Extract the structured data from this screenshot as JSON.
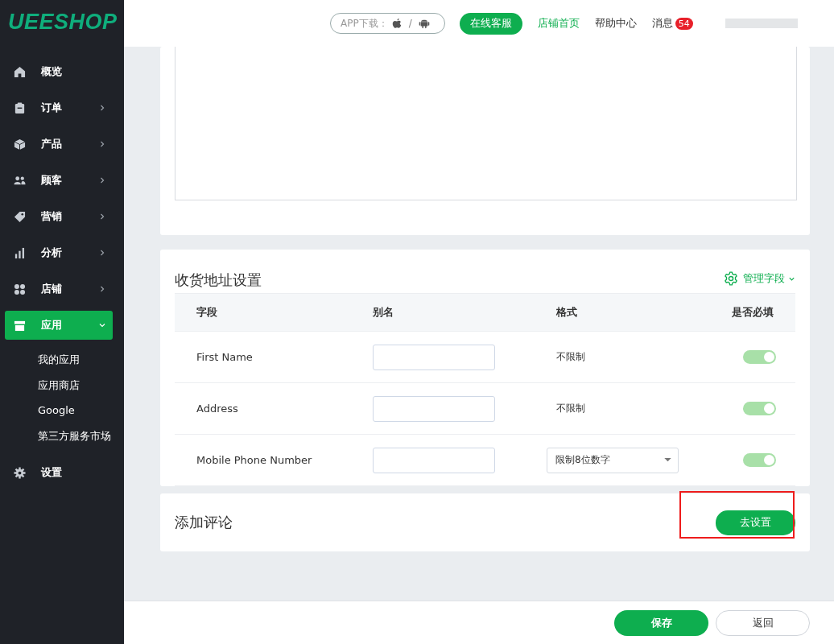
{
  "logo": "UEESHOP",
  "sidebar": {
    "items": [
      {
        "label": "概览",
        "selected": false
      },
      {
        "label": "订单",
        "selected": false,
        "expanded": false
      },
      {
        "label": "产品",
        "selected": false,
        "expanded": false
      },
      {
        "label": "顾客",
        "selected": false,
        "expanded": false
      },
      {
        "label": "营销",
        "selected": false,
        "expanded": false
      },
      {
        "label": "分析",
        "selected": false,
        "expanded": false
      },
      {
        "label": "店铺",
        "selected": false,
        "expanded": false
      },
      {
        "label": "应用",
        "selected": true,
        "expanded": true,
        "children": [
          {
            "label": "我的应用"
          },
          {
            "label": "应用商店"
          },
          {
            "label": "Google"
          },
          {
            "label": "第三方服务市场"
          }
        ]
      },
      {
        "label": "设置",
        "selected": false
      }
    ]
  },
  "topbar": {
    "app_download": "APP下载：",
    "separator": "/",
    "service_button": "在线客服",
    "links": [
      {
        "label": "店铺首页",
        "highlighted": true
      },
      {
        "label": "帮助中心",
        "highlighted": false
      }
    ],
    "messages": {
      "label": "消息",
      "count": "54"
    }
  },
  "address_settings": {
    "title": "收货地址设置",
    "manage_fields": "管理字段",
    "columns": [
      "字段",
      "别名",
      "格式",
      "是否必填"
    ],
    "rows": [
      {
        "field": "First Name",
        "format": {
          "kind": "text",
          "value": "不限制"
        },
        "on": true
      },
      {
        "field": "Address",
        "format": {
          "kind": "text",
          "value": "不限制"
        },
        "on": true
      },
      {
        "field": "Mobile Phone Number",
        "format": {
          "kind": "select",
          "value": "限制8位数字"
        },
        "on": true
      }
    ]
  },
  "reviews": {
    "title": "添加评论",
    "button": "去设置",
    "highlighted": true
  },
  "footer": {
    "save": "保存",
    "back": "返回"
  }
}
